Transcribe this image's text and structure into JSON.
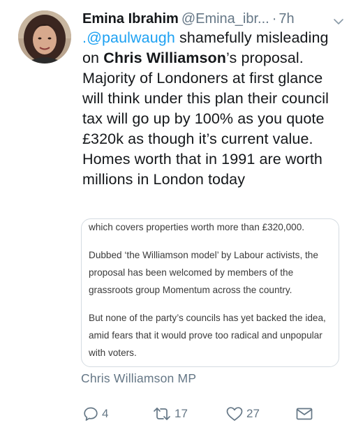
{
  "tweet": {
    "display_name": "Emina Ibrahim",
    "handle": "@Emina_ibr...",
    "separator": "·",
    "time": "7h",
    "text_mention": ".@paulwaugh",
    "text_part1": " shamefully misleading on ",
    "text_bold": "Chris Williamson",
    "text_part2": "’s proposal. Majority of Londoners at first glance will think under this plan their council tax will go up by 100% as you quote £320k as though it’s current value. Homes worth that in 1991 are worth millions in London today"
  },
  "quote_image": {
    "lines": [
      "which covers properties worth more than £320,000.",
      "",
      "Dubbed ‘the Williamson model’ by Labour activists, the",
      "proposal has been welcomed by members of the",
      "grassroots group Momentum across the country.",
      "",
      "But none of the party’s councils has yet backed the idea,",
      "amid fears that it would prove too radical and unpopular",
      "with voters."
    ]
  },
  "attribution": "Chris Williamson MP",
  "actions": {
    "reply_icon": "speech-bubble-icon",
    "reply_count": "4",
    "retweet_icon": "retweet-arrows-icon",
    "retweet_count": "17",
    "like_icon": "heart-icon",
    "like_count": "27",
    "dm_icon": "envelope-icon"
  },
  "colors": {
    "link": "#1da1f2",
    "secondary": "#657786",
    "text": "#14171a",
    "border": "#d4dbe1"
  }
}
